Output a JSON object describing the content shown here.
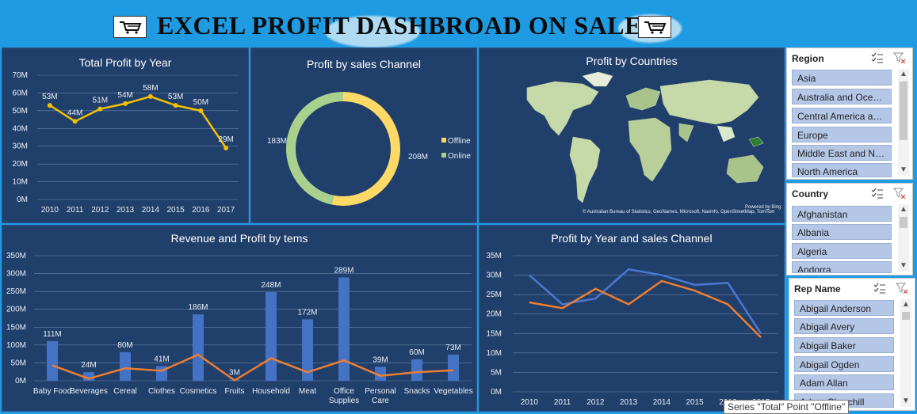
{
  "header": {
    "title": "EXCEL PROFIT DASHBROAD ON SALES",
    "left_icon": "shopping-cart-icon",
    "right_icon": "shopping-cart-icon"
  },
  "colors": {
    "background": "#1e9be2",
    "panel": "#203f6b",
    "line_yellow": "#f5c000",
    "offline": "#ffd966",
    "online": "#a9d18e",
    "bar_blue": "#4472c4",
    "line_orange": "#ed7d31",
    "slicer_item": "#b4c7e7"
  },
  "chart_data": [
    {
      "type": "line",
      "title": "Total Profit by Year",
      "x": [
        "2010",
        "2011",
        "2012",
        "2013",
        "2014",
        "2015",
        "2016",
        "2017"
      ],
      "values": [
        53,
        44,
        51,
        54,
        58,
        53,
        50,
        29
      ],
      "data_labels": [
        "53M",
        "44M",
        "51M",
        "54M",
        "58M",
        "53M",
        "50M",
        "29M"
      ],
      "y_ticks": [
        "0M",
        "10M",
        "20M",
        "30M",
        "40M",
        "50M",
        "60M",
        "70M"
      ],
      "ylim": [
        0,
        70
      ],
      "unit": "M"
    },
    {
      "type": "pie",
      "title": "Profit by sales Channel",
      "categories": [
        "Offline",
        "Online"
      ],
      "values": [
        208,
        183
      ],
      "data_labels": [
        "208M",
        "183M"
      ],
      "legend": "right"
    },
    {
      "type": "map",
      "title": "Profit by Countries",
      "attribution": "© Australian Bureau of Statistics, GeoNames, Microsoft, Navinfo, OpenStreetMap, TomTom",
      "powered_by": "Powered by Bing"
    },
    {
      "type": "bar",
      "title": "Revenue and Profit by tems",
      "categories": [
        "Baby Food",
        "Beverages",
        "Cereal",
        "Clothes",
        "Cosmetics",
        "Fruits",
        "Household",
        "Meat",
        "Office Supplies",
        "Personal Care",
        "Snacks",
        "Vegetables"
      ],
      "category_labels": [
        [
          "Baby Food"
        ],
        [
          "Beverages"
        ],
        [
          "Cereal"
        ],
        [
          "Clothes"
        ],
        [
          "Cosmetics"
        ],
        [
          "Fruits"
        ],
        [
          "Household"
        ],
        [
          "Meat"
        ],
        [
          "Office",
          "Supplies"
        ],
        [
          "Personal",
          "Care"
        ],
        [
          "Snacks"
        ],
        [
          "Vegetables"
        ]
      ],
      "series": [
        {
          "name": "Revenue",
          "values": [
            111,
            24,
            80,
            41,
            186,
            3,
            248,
            172,
            289,
            39,
            60,
            73
          ],
          "data_labels": [
            "111M",
            "24M",
            "80M",
            "41M",
            "186M",
            "3M",
            "248M",
            "172M",
            "289M",
            "39M",
            "60M",
            "73M"
          ]
        },
        {
          "name": "Profit",
          "values": [
            43,
            6,
            35,
            28,
            73,
            1,
            63,
            24,
            57,
            14,
            24,
            29
          ]
        }
      ],
      "y_ticks": [
        "0M",
        "50M",
        "100M",
        "150M",
        "200M",
        "250M",
        "300M",
        "350M"
      ],
      "ylim": [
        0,
        350
      ]
    },
    {
      "type": "line",
      "title": "Profit by Year and sales Channel",
      "x": [
        "2010",
        "2011",
        "2012",
        "2013",
        "2014",
        "2015",
        "2016",
        "2017"
      ],
      "series": [
        {
          "name": "Offline",
          "values": [
            30,
            22.5,
            24,
            31.5,
            30,
            27.5,
            28,
            15
          ]
        },
        {
          "name": "Online",
          "values": [
            23,
            21.5,
            26.5,
            22.5,
            28.5,
            26,
            22.5,
            14
          ]
        }
      ],
      "y_ticks": [
        "0M",
        "5M",
        "10M",
        "15M",
        "20M",
        "25M",
        "30M",
        "35M"
      ],
      "ylim": [
        0,
        35
      ]
    }
  ],
  "slicers": {
    "region": {
      "title": "Region",
      "items": [
        "Asia",
        "Australia and Oceania",
        "Central America an...",
        "Europe",
        "Middle East and No...",
        "North America"
      ]
    },
    "country": {
      "title": "Country",
      "items": [
        "Afghanistan",
        "Albania",
        "Algeria",
        "Andorra"
      ]
    },
    "rep": {
      "title": "Rep Name",
      "items": [
        "Abigail Anderson",
        "Abigail Avery",
        "Abigail Baker",
        "Abigail Ogden",
        "Adam Allan",
        "Adam Churchill"
      ]
    }
  },
  "tooltip": "Series \"Total\" Point \"Offline\""
}
